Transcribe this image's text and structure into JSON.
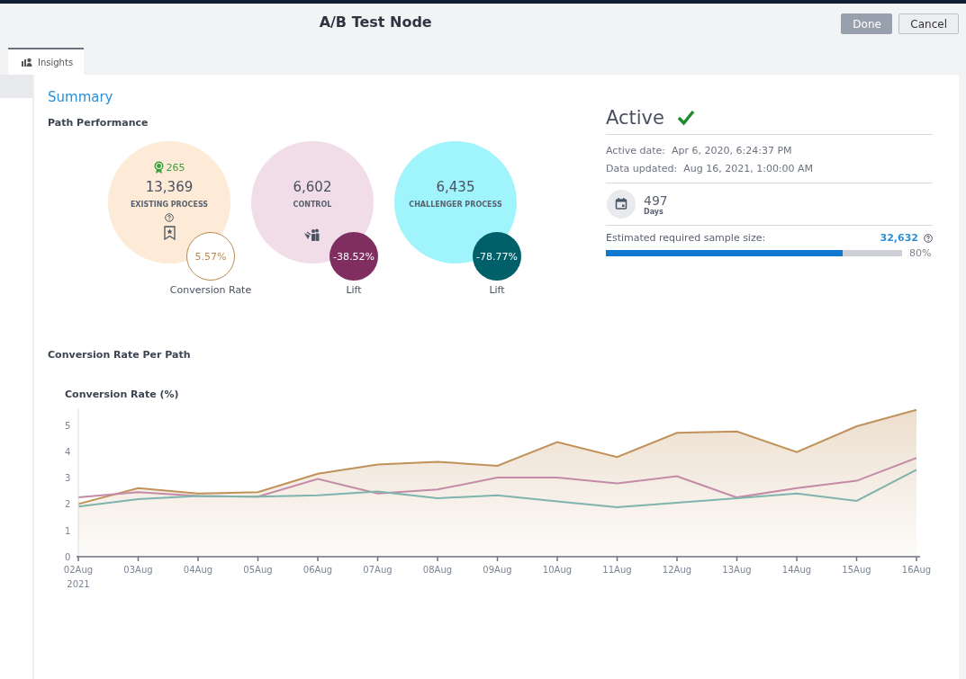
{
  "header": {
    "title": "A/B Test Node",
    "buttons": [
      {
        "label": "Done",
        "disabled": true
      },
      {
        "label": "Cancel",
        "disabled": false
      }
    ]
  },
  "tabs": [
    {
      "label": "Insights",
      "selected": true
    }
  ],
  "summary": {
    "title": "Summary",
    "path_performance": {
      "title": "Path Performance",
      "paths": [
        {
          "kind": "existing",
          "badge": "265",
          "count": "13,369",
          "label": "EXISTING PROCESS",
          "color": "#fdebd7",
          "metric": {
            "value": "5.57%",
            "kind": "outline",
            "color": "#b98a4e"
          },
          "metric_label": "Conversion Rate"
        },
        {
          "kind": "control",
          "count": "6,602",
          "label": "CONTROL",
          "color": "#f1dde7",
          "metric": {
            "value": "-38.52%",
            "kind": "filled",
            "color": "#7f2e5f"
          },
          "metric_label": "Lift"
        },
        {
          "kind": "challenger",
          "count": "6,435",
          "label": "CHALLENGER PROCESS",
          "color": "#a0f4fc",
          "metric": {
            "value": "-78.77%",
            "kind": "filled",
            "color": "#00606a"
          },
          "metric_label": "Lift"
        }
      ]
    },
    "status": {
      "label": "Active",
      "active": true,
      "active_date_label": "Active date:",
      "active_date": "Apr 6, 2020, 6:24:37 PM",
      "data_updated_label": "Data updated:",
      "data_updated": "Aug 16, 2021, 1:00:00 AM",
      "days": "497",
      "days_label": "Days",
      "sample_label": "Estimated required sample size:",
      "sample_size": "32,632",
      "progress": {
        "level": 0.8,
        "reading": "80%"
      }
    },
    "conversion": {
      "title": "Conversion Rate Per Path",
      "chart_data": {
        "type": "area",
        "ylabel": "Conversion Rate (%)",
        "categories": [
          "02Aug",
          "03Aug",
          "04Aug",
          "05Aug",
          "06Aug",
          "07Aug",
          "08Aug",
          "09Aug",
          "10Aug",
          "11Aug",
          "12Aug",
          "13Aug",
          "14Aug",
          "15Aug",
          "16Aug"
        ],
        "annotations": [
          "2021"
        ],
        "ylim": [
          0,
          5.6
        ],
        "yticks": [
          0,
          1,
          2,
          3,
          4,
          5
        ],
        "series": [
          {
            "color": "#c0925a",
            "values": [
              2.0,
              2.6,
              2.4,
              2.45,
              3.15,
              3.5,
              3.6,
              3.45,
              4.35,
              3.78,
              4.7,
              4.75,
              3.97,
              4.95,
              5.57
            ]
          },
          {
            "color": "#c48ba8",
            "type": "line",
            "values": [
              2.25,
              2.45,
              2.3,
              2.28,
              2.95,
              2.4,
              2.55,
              3.0,
              3.0,
              2.78,
              3.05,
              2.25,
              2.6,
              2.88,
              3.75
            ]
          },
          {
            "color": "#7fb3ad",
            "type": "line",
            "values": [
              1.9,
              2.18,
              2.3,
              2.28,
              2.33,
              2.47,
              2.22,
              2.33,
              2.1,
              1.88,
              2.05,
              2.22,
              2.4,
              2.12,
              3.3
            ]
          }
        ]
      }
    }
  }
}
